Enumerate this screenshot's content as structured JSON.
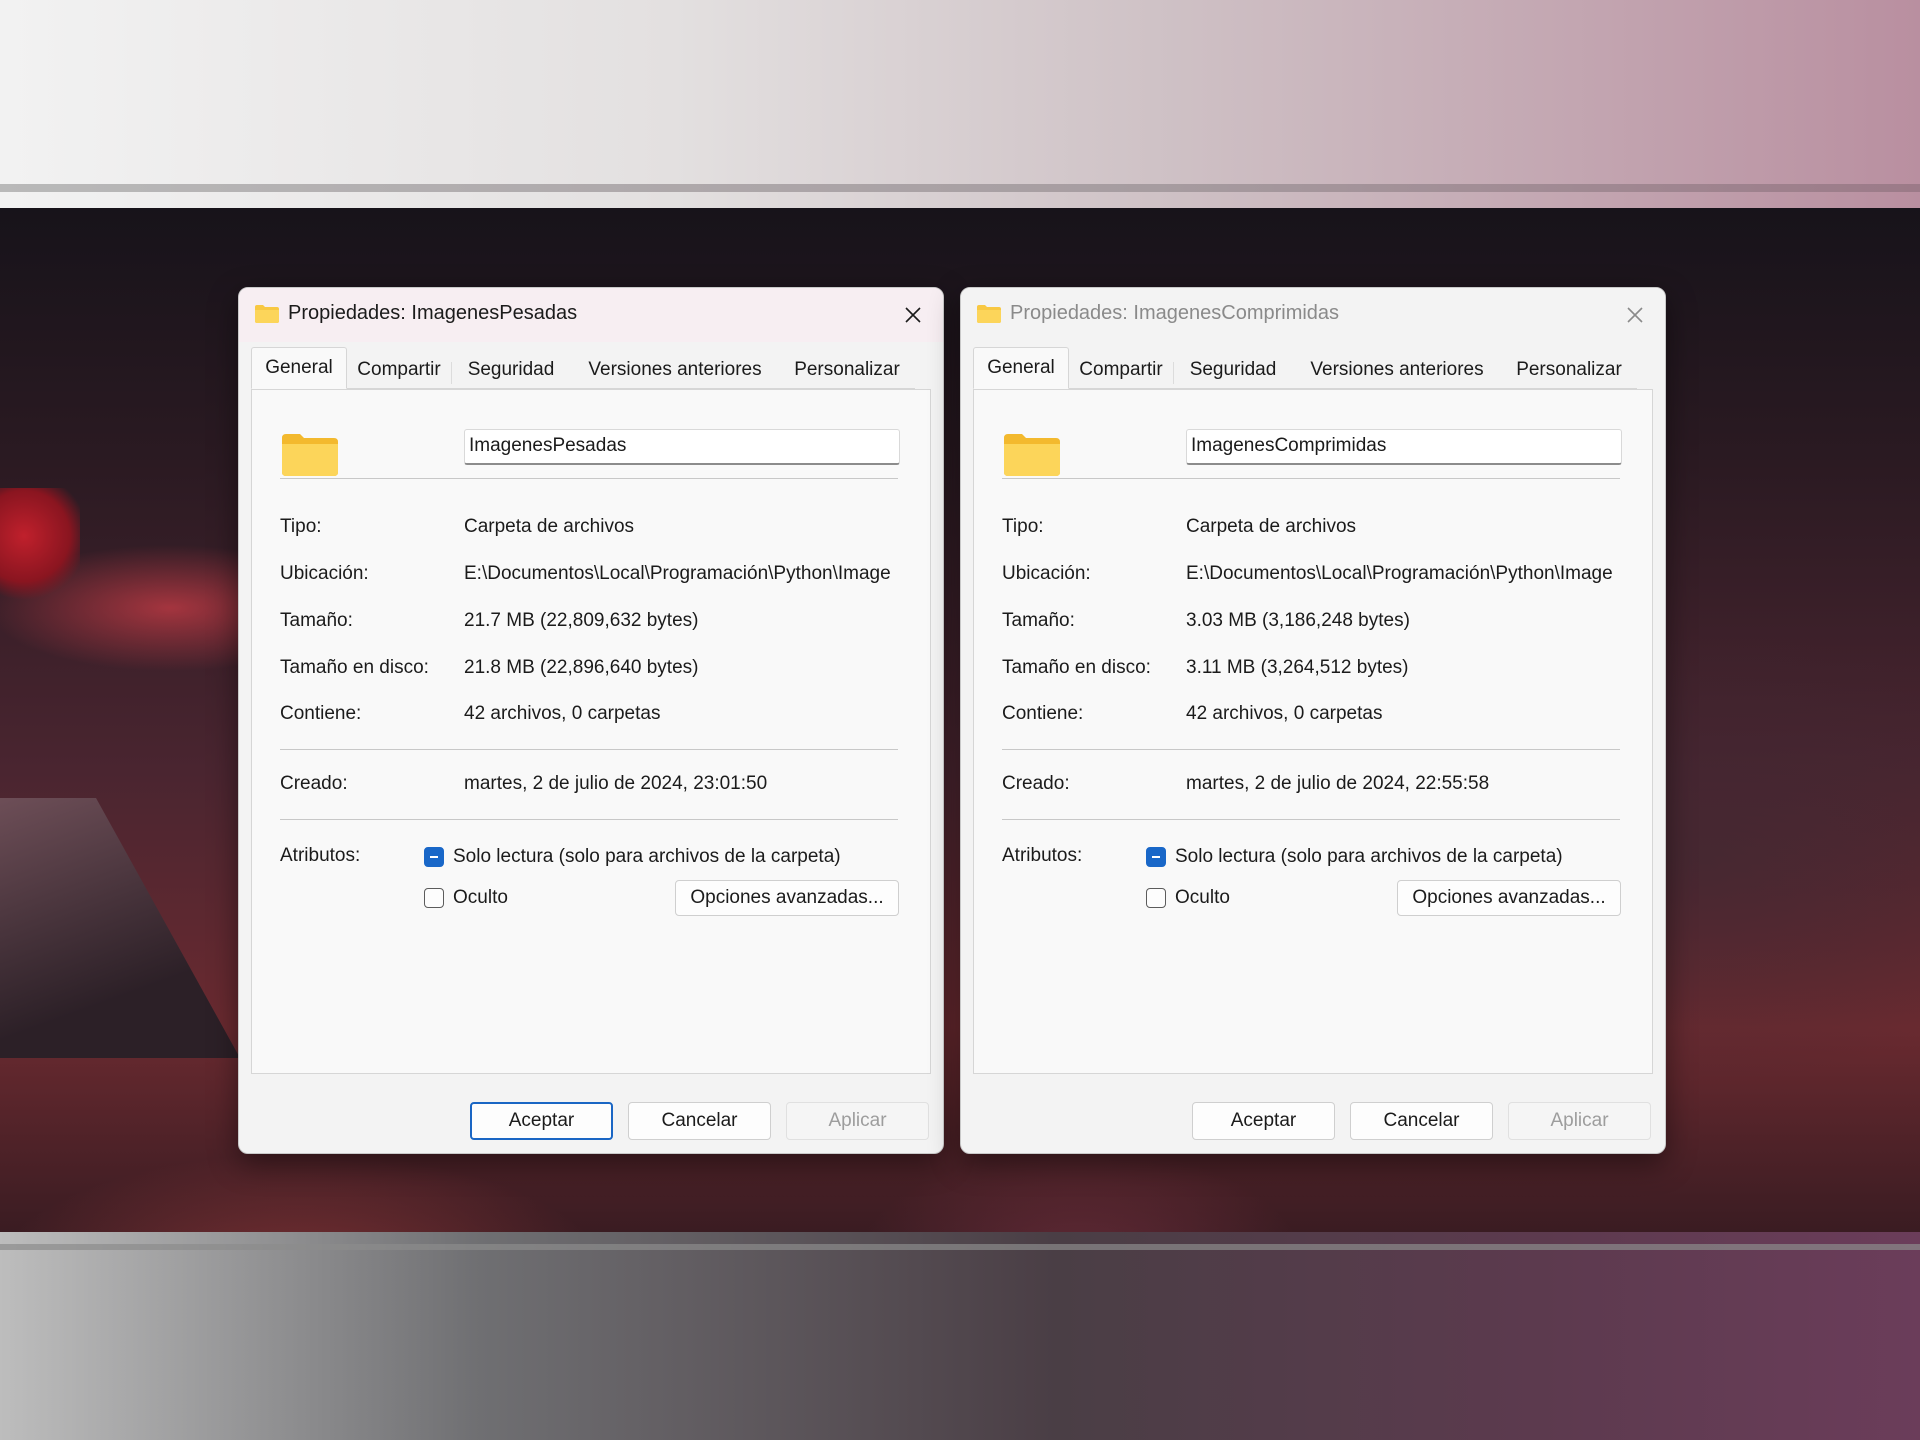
{
  "dialogs": [
    {
      "title": "Propiedades: ImagenesPesadas",
      "tabs": [
        "General",
        "Compartir",
        "Seguridad",
        "Versiones anteriores",
        "Personalizar"
      ],
      "active_tab": "General",
      "name": "ImagenesPesadas",
      "rows": {
        "tipo_label": "Tipo:",
        "tipo": "Carpeta de archivos",
        "ubicacion_label": "Ubicación:",
        "ubicacion": "E:\\Documentos\\Local\\Programación\\Python\\Image",
        "tamano_label": "Tamaño:",
        "tamano": "21.7 MB (22,809,632 bytes)",
        "tamano_disco_label": "Tamaño en disco:",
        "tamano_disco": "21.8 MB (22,896,640 bytes)",
        "contiene_label": "Contiene:",
        "contiene": "42 archivos, 0 carpetas",
        "creado_label": "Creado:",
        "creado": "martes, 2 de julio de 2024, 23:01:50"
      },
      "atributos_label": "Atributos:",
      "solo_lectura": "Solo lectura (solo para archivos de la carpeta)",
      "solo_lectura_state": "indeterminate",
      "oculto": "Oculto",
      "oculto_checked": false,
      "advanced": "Opciones avanzadas...",
      "buttons": {
        "ok": "Aceptar",
        "cancel": "Cancelar",
        "apply": "Aplicar"
      },
      "focused": true
    },
    {
      "title": "Propiedades: ImagenesComprimidas",
      "tabs": [
        "General",
        "Compartir",
        "Seguridad",
        "Versiones anteriores",
        "Personalizar"
      ],
      "active_tab": "General",
      "name": "ImagenesComprimidas",
      "rows": {
        "tipo_label": "Tipo:",
        "tipo": "Carpeta de archivos",
        "ubicacion_label": "Ubicación:",
        "ubicacion": "E:\\Documentos\\Local\\Programación\\Python\\Image",
        "tamano_label": "Tamaño:",
        "tamano": "3.03 MB (3,186,248 bytes)",
        "tamano_disco_label": "Tamaño en disco:",
        "tamano_disco": "3.11 MB (3,264,512 bytes)",
        "contiene_label": "Contiene:",
        "contiene": "42 archivos, 0 carpetas",
        "creado_label": "Creado:",
        "creado": "martes, 2 de julio de 2024, 22:55:58"
      },
      "atributos_label": "Atributos:",
      "solo_lectura": "Solo lectura (solo para archivos de la carpeta)",
      "solo_lectura_state": "indeterminate",
      "oculto": "Oculto",
      "oculto_checked": false,
      "advanced": "Opciones avanzadas...",
      "buttons": {
        "ok": "Aceptar",
        "cancel": "Cancelar",
        "apply": "Aplicar"
      },
      "focused": false
    }
  ],
  "colors": {
    "accent": "#1967c8",
    "folder": "#f8c842",
    "title_active_bg": "#f7eef2",
    "disabled_text": "#9d9d9d"
  },
  "icons": [
    "folder-icon",
    "close-icon",
    "checkbox-indeterminate-icon",
    "checkbox-empty-icon"
  ]
}
